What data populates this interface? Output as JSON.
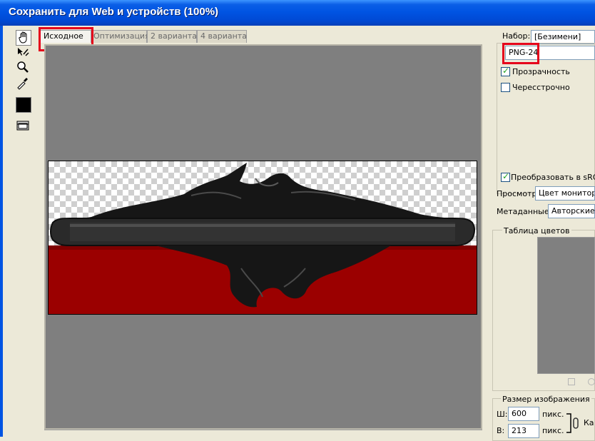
{
  "window": {
    "title": "Сохранить для Web и устройств (100%)"
  },
  "tabs": [
    {
      "label": "Исходное",
      "selected": true
    },
    {
      "label": "Оптимизация",
      "selected": false
    },
    {
      "label": "2 варианта",
      "selected": false
    },
    {
      "label": "4 варианта",
      "selected": false
    }
  ],
  "tools": [
    "hand-tool",
    "slice-select-tool",
    "zoom-tool",
    "eyedropper-tool",
    "eyedropper-color",
    "toggle-slices-visibility"
  ],
  "settings": {
    "preset_label": "Набор:",
    "preset_value": "[Безимени]",
    "format_value": "PNG-24",
    "transparency_label": "Прозрачность",
    "transparency_checked": true,
    "interlaced_label": "Чересстрочно",
    "interlaced_checked": false,
    "convert_srgb_label": "Преобразовать в sRGB",
    "convert_srgb_checked": true,
    "preview_label": "Просмотр:",
    "preview_value": "Цвет монитора",
    "metadata_label": "Метаданные:",
    "metadata_value": "Авторские п"
  },
  "color_table": {
    "title": "Таблица цветов"
  },
  "image_size": {
    "title": "Размер изображения",
    "width_label": "Ш:",
    "width_value": "600",
    "height_label": "В:",
    "height_value": "213",
    "unit": "пикс.",
    "extra_label": "Ка"
  },
  "colors": {
    "title_bar": "#0054e3",
    "highlight": "#e5001b",
    "canvas_bg": "#7f7f7f",
    "banner_red": "#9b0000",
    "banner_black": "#1a1a1a"
  }
}
